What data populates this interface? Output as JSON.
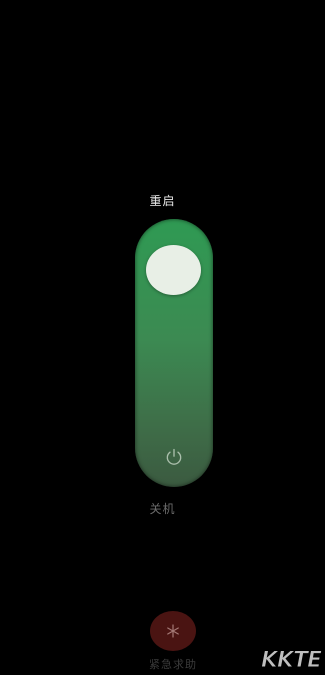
{
  "power_menu": {
    "restart_label": "重启",
    "shutdown_label": "关机",
    "emergency_label": "紧急求助"
  },
  "colors": {
    "background": "#000000",
    "track_top": "#2f9a53",
    "track_bottom": "#3b5a40",
    "knob": "#e8efe6",
    "emergency_button": "#4a1412"
  },
  "icons": {
    "power": "power-icon",
    "emergency": "asterisk-icon"
  },
  "watermark": {
    "text": "KKTE"
  }
}
